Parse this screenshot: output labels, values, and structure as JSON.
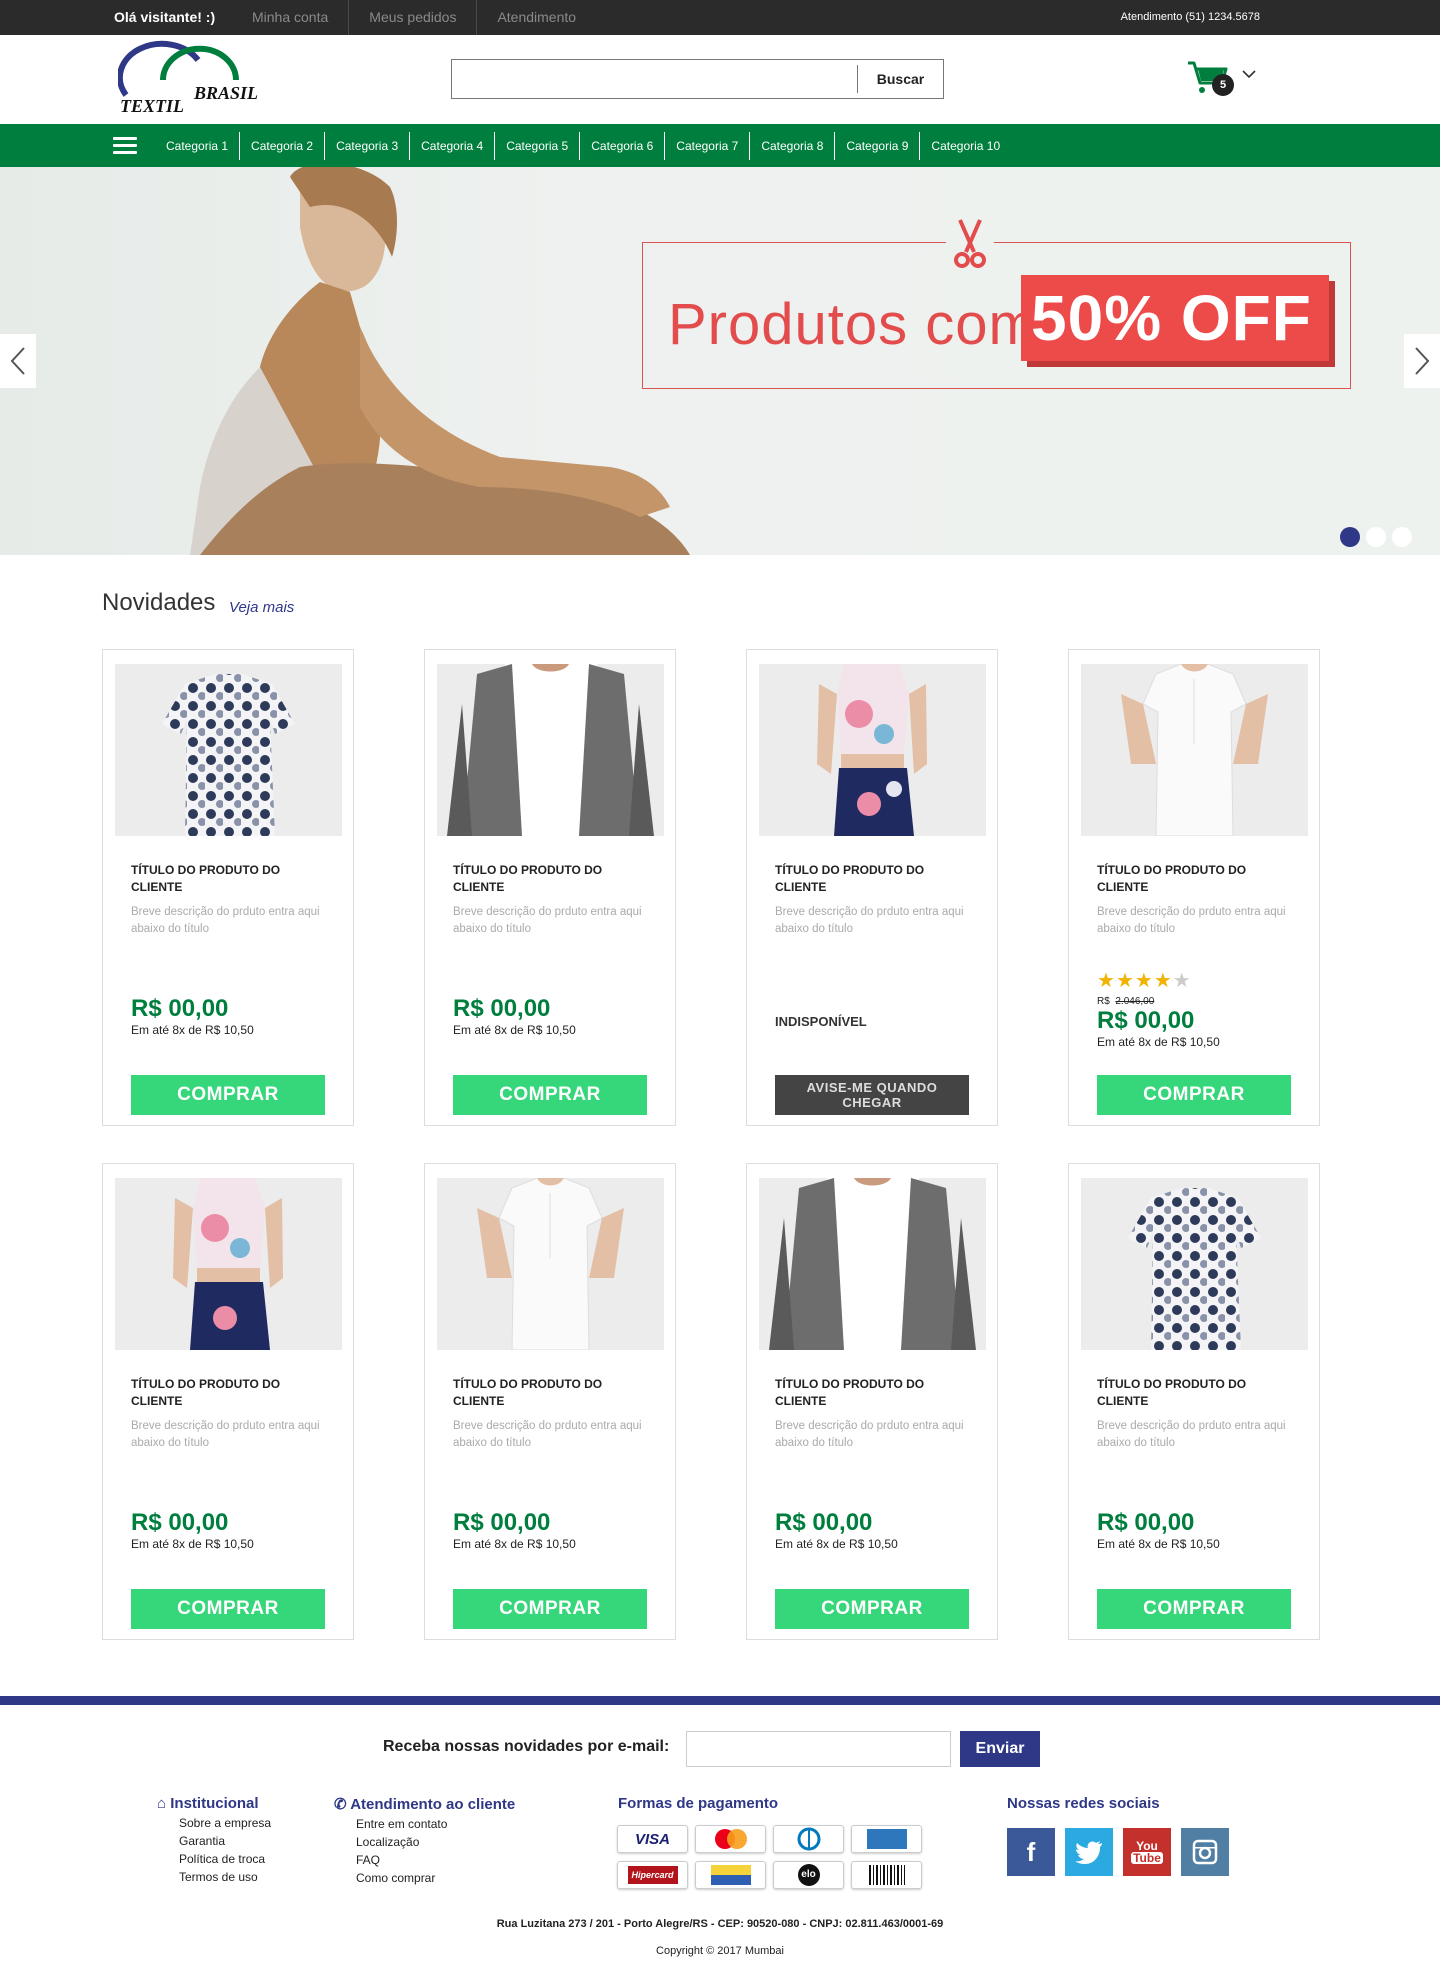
{
  "topbar": {
    "greeting": "Olá visitante! :)",
    "links": [
      "Minha conta",
      "Meus pedidos",
      "Atendimento"
    ],
    "phone": "Atendimento (51) 1234.5678"
  },
  "header": {
    "logo_line1": "BRASIL",
    "logo_line2": "TEXTIL",
    "search_placeholder": "",
    "search_button": "Buscar",
    "cart_count": "5"
  },
  "nav": {
    "categories": [
      "Categoria 1",
      "Categoria 2",
      "Categoria 3",
      "Categoria 4",
      "Categoria 5",
      "Categoria 6",
      "Categoria 7",
      "Categoria 8",
      "Categoria 9",
      "Categoria 10"
    ]
  },
  "hero": {
    "promo_text": "Produtos com",
    "promo_highlight": "50% OFF",
    "slide_count": 3,
    "active_slide": 1
  },
  "section": {
    "title": "Novidades",
    "link": "Veja mais"
  },
  "products": [
    {
      "title": "Título do produto do cliente",
      "desc": "Breve descrição do prduto entra aqui abaixo do título",
      "price": "R$ 00,00",
      "installments": "Em até 8x de R$ 10,50",
      "button": "COMPRAR",
      "image": "floral-dress"
    },
    {
      "title": "Título do produto do cliente",
      "desc": "Breve descrição do prduto entra aqui abaixo do título",
      "price": "R$ 00,00",
      "installments": "Em até 8x de R$ 10,50",
      "button": "COMPRAR",
      "image": "grey-cardigan"
    },
    {
      "title": "Título do produto do cliente",
      "desc": "Breve descrição do prduto entra aqui abaixo do título",
      "status": "INDISPONÍVEL",
      "button": "AVISE-ME QUANDO CHEGAR",
      "image": "floral-crop-top"
    },
    {
      "title": "Título do produto do cliente",
      "desc": "Breve descrição do prduto entra aqui abaixo do título",
      "rating": 4,
      "rating_max": 5,
      "old_price_prefix": "R$",
      "old_price": "2.046,00",
      "price": "R$ 00,00",
      "installments": "Em até 8x de R$ 10,50",
      "button": "COMPRAR",
      "image": "white-blouse"
    },
    {
      "title": "Título do produto do cliente",
      "desc": "Breve descrição do prduto entra aqui abaixo do título",
      "price": "R$ 00,00",
      "installments": "Em até 8x de R$ 10,50",
      "button": "COMPRAR",
      "image": "floral-crop-top"
    },
    {
      "title": "Título do produto do cliente",
      "desc": "Breve descrição do prduto entra aqui abaixo do título",
      "price": "R$ 00,00",
      "installments": "Em até 8x de R$ 10,50",
      "button": "COMPRAR",
      "image": "white-blouse"
    },
    {
      "title": "Título do produto do cliente",
      "desc": "Breve descrição do prduto entra aqui abaixo do título",
      "price": "R$ 00,00",
      "installments": "Em até 8x de R$ 10,50",
      "button": "COMPRAR",
      "image": "grey-cardigan"
    },
    {
      "title": "Título do produto do cliente",
      "desc": "Breve descrição do prduto entra aqui abaixo do título",
      "price": "R$ 00,00",
      "installments": "Em até 8x de R$ 10,50",
      "button": "COMPRAR",
      "image": "floral-dress"
    }
  ],
  "footer": {
    "newsletter_label": "Receba nossas novidades por e-mail:",
    "newsletter_button": "Enviar",
    "institucional": {
      "title": "Institucional",
      "items": [
        "Sobre a empresa",
        "Garantia",
        "Política de troca",
        "Termos de uso"
      ]
    },
    "atendimento": {
      "title": "Atendimento ao cliente",
      "items": [
        "Entre em contato",
        "Localização",
        "FAQ",
        "Como comprar"
      ]
    },
    "pagamento": {
      "title": "Formas de pagamento",
      "methods": [
        "VISA",
        "MasterCard",
        "Diners",
        "AmEx",
        "Hipercard",
        "Aura",
        "elo",
        "Boleto"
      ]
    },
    "redes": {
      "title": "Nossas redes sociais",
      "networks": [
        "facebook",
        "twitter",
        "youtube",
        "instagram"
      ]
    },
    "address": "Rua Luzitana 273 / 201 - Porto Alegre/RS - CEP: 90520-080 - CNPJ: 02.811.463/0001-69",
    "copyright": "Copyright © 2017 Mumbai"
  },
  "colors": {
    "green_nav": "#007e3e",
    "green_button": "#36d67a",
    "navy": "#2f3787",
    "promo_red": "#ed4a4a"
  }
}
